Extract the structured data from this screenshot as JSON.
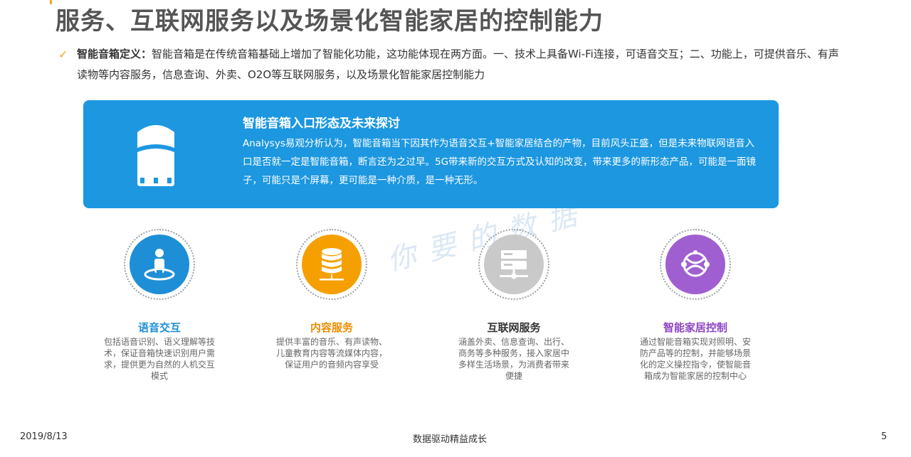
{
  "title": "服务、互联网服务以及场景化智能家居的控制能力",
  "definition": {
    "label": "智能音箱定义：",
    "text": "智能音箱是在传统音箱基础上增加了智能化功能，这功能体现在两方面。一、技术上具备Wi-Fi连接，可语音交互；二、功能上，可提供音乐、有声读物等内容服务，信息查询、外卖、O2O等互联网服务，以及场景化智能家居控制能力"
  },
  "banner": {
    "title": "智能音箱入口形态及未来探讨",
    "body": "Analysys易观分析认为，智能音箱当下因其作为语音交互+智能家居结合的产物，目前风头正盛，但是未来物联网语音入口是否就一定是智能音箱，断言还为之过早。5G带来新的交互方式及认知的改变，带来更多的新形态产品，可能是一面镜子，可能只是个屏幕，更可能是一种介质，是一种无形。"
  },
  "watermark": "你要的数据",
  "features": [
    {
      "icon": "person-on-platform-icon",
      "title": "语音交互",
      "desc": "包括语音识别、语义理解等技术，保证音箱快速识别用户需求，提供更为自然的人机交互模式",
      "color": "#1e8fd6"
    },
    {
      "icon": "database-icon",
      "title": "内容服务",
      "desc": "提供丰富的音乐、有声读物、儿童教育内容等流媒体内容，保证用户的音频内容享受",
      "color": "#f5a000"
    },
    {
      "icon": "server-network-icon",
      "title": "互联网服务",
      "desc": "涵盖外卖、信息查询、出行、商务等多种服务，接入家居中多样生活场景，为消费者带来便捷",
      "color": "#c9c9c9"
    },
    {
      "icon": "network-globe-icon",
      "title": "智能家居控制",
      "desc": "通过智能音箱实现对照明、安防产品等的控制，并能够场景化的定义操控指令，使智能音箱成为智能家居的控制中心",
      "color": "#9f5fd1"
    }
  ],
  "footer": {
    "date": "2019/8/13",
    "slogan": "数据驱动精益成长",
    "page": "5"
  }
}
